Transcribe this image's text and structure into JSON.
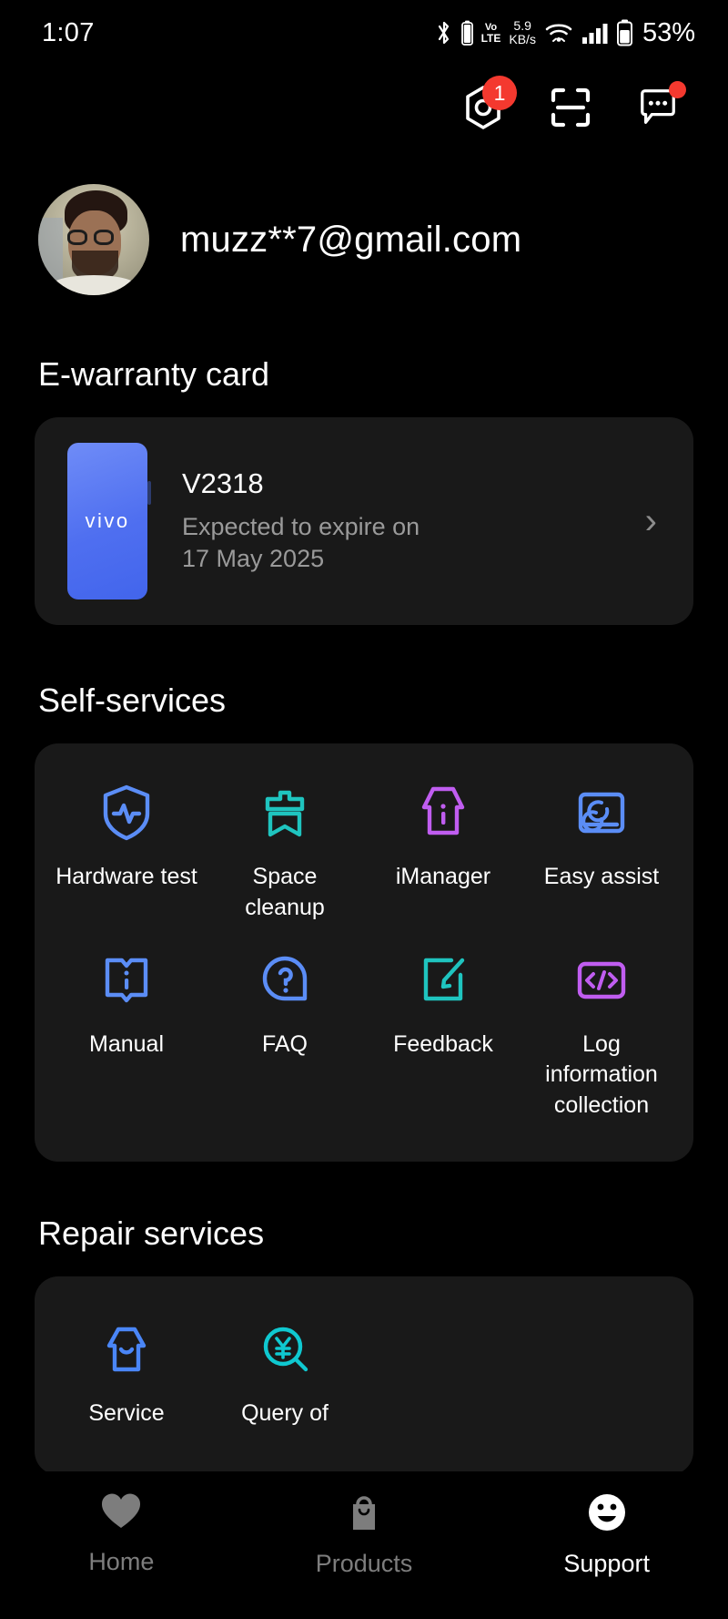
{
  "status_bar": {
    "time": "1:07",
    "bluetooth_icon": "bluetooth-icon",
    "volte_top": "Vo",
    "volte_bottom": "LTE",
    "net_speed_value": "5.9",
    "net_speed_unit": "KB/s",
    "wifi_icon": "wifi-icon",
    "signal_icon": "cellular-signal-icon",
    "battery_icon": "battery-icon",
    "battery_percent": "53%"
  },
  "top_actions": [
    {
      "name": "service-center-button",
      "icon": "hex-nut-icon",
      "badge": "1"
    },
    {
      "name": "scan-button",
      "icon": "scan-frame-icon",
      "badge": ""
    },
    {
      "name": "messages-button",
      "icon": "chat-bubble-icon",
      "badge": "dot"
    }
  ],
  "profile": {
    "avatar": "user-avatar",
    "email": "muzz**7@gmail.com"
  },
  "warranty": {
    "section_title": "E-warranty card",
    "brand": "vivo",
    "model": "V2318",
    "expire_label": "Expected to expire on",
    "expire_date": "17 May 2025",
    "chevron": "›"
  },
  "self_services": {
    "section_title": "Self-services",
    "items": [
      {
        "label": "Hardware test",
        "icon": "shield-pulse-icon",
        "color": "#5b8df6"
      },
      {
        "label": "Space cleanup",
        "icon": "broom-cleanup-icon",
        "color": "#1fc4bf"
      },
      {
        "label": "iManager",
        "icon": "imanager-house-info-icon",
        "color": "#c05df0"
      },
      {
        "label": "Easy assist",
        "icon": "screen-sync-icon",
        "color": "#5b8df6"
      },
      {
        "label": "Manual",
        "icon": "open-book-info-icon",
        "color": "#5b8df6"
      },
      {
        "label": "FAQ",
        "icon": "question-bubble-icon",
        "color": "#5b8df6"
      },
      {
        "label": "Feedback",
        "icon": "edit-square-pencil-icon",
        "color": "#1fc4bf"
      },
      {
        "label": "Log information collection",
        "icon": "code-brackets-icon",
        "color": "#c05df0"
      }
    ]
  },
  "repair_services": {
    "section_title": "Repair services",
    "items": [
      {
        "label": "Service",
        "icon": "service-store-icon",
        "color": "#4a86f7"
      },
      {
        "label": "Query of",
        "icon": "price-query-magnifier-icon",
        "color": "#0fc8d0"
      }
    ]
  },
  "bottom_nav": {
    "items": [
      {
        "label": "Home",
        "icon": "heart-icon",
        "active": false
      },
      {
        "label": "Products",
        "icon": "shopping-bag-icon",
        "active": false
      },
      {
        "label": "Support",
        "icon": "smiley-face-icon",
        "active": true
      }
    ]
  },
  "theme": {
    "background": "#000000",
    "card": "#191919",
    "accent_red": "#f4392f",
    "muted_text": "#9a9a9a"
  }
}
